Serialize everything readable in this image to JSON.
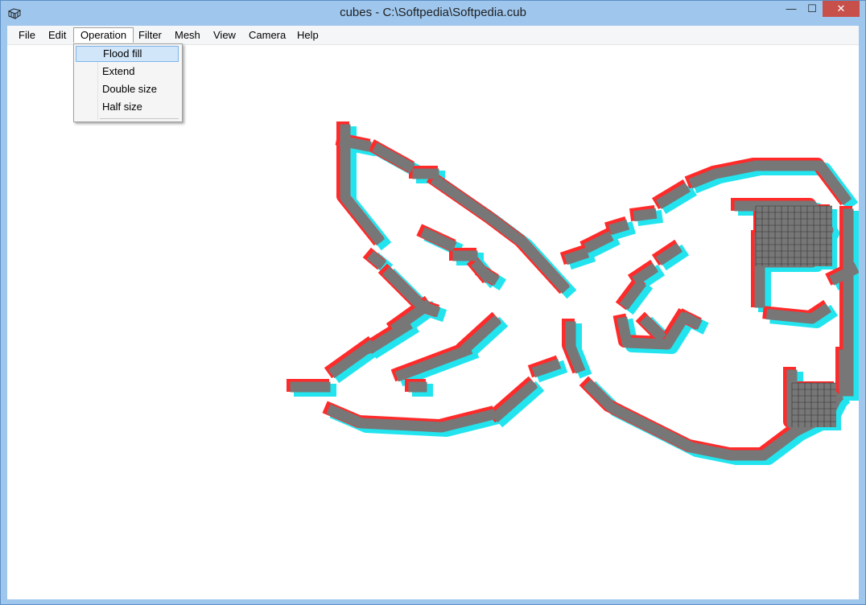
{
  "window": {
    "title": "cubes - C:\\Softpedia\\Softpedia.cub",
    "controls": {
      "minimize": "—",
      "maximize": "☐",
      "close": "✕"
    }
  },
  "menubar": {
    "items": [
      "File",
      "Edit",
      "Operation",
      "Filter",
      "Mesh",
      "View",
      "Camera",
      "Help"
    ],
    "active": "Operation"
  },
  "dropdown": {
    "items": [
      "Flood fill",
      "Extend",
      "Double size",
      "Half size"
    ],
    "highlighted": "Flood fill"
  },
  "colors": {
    "cube_fill": "#777777",
    "left_eye": "#ff2a2a",
    "right_eye": "#22e4ee",
    "titlebar": "#9fc7ee"
  }
}
